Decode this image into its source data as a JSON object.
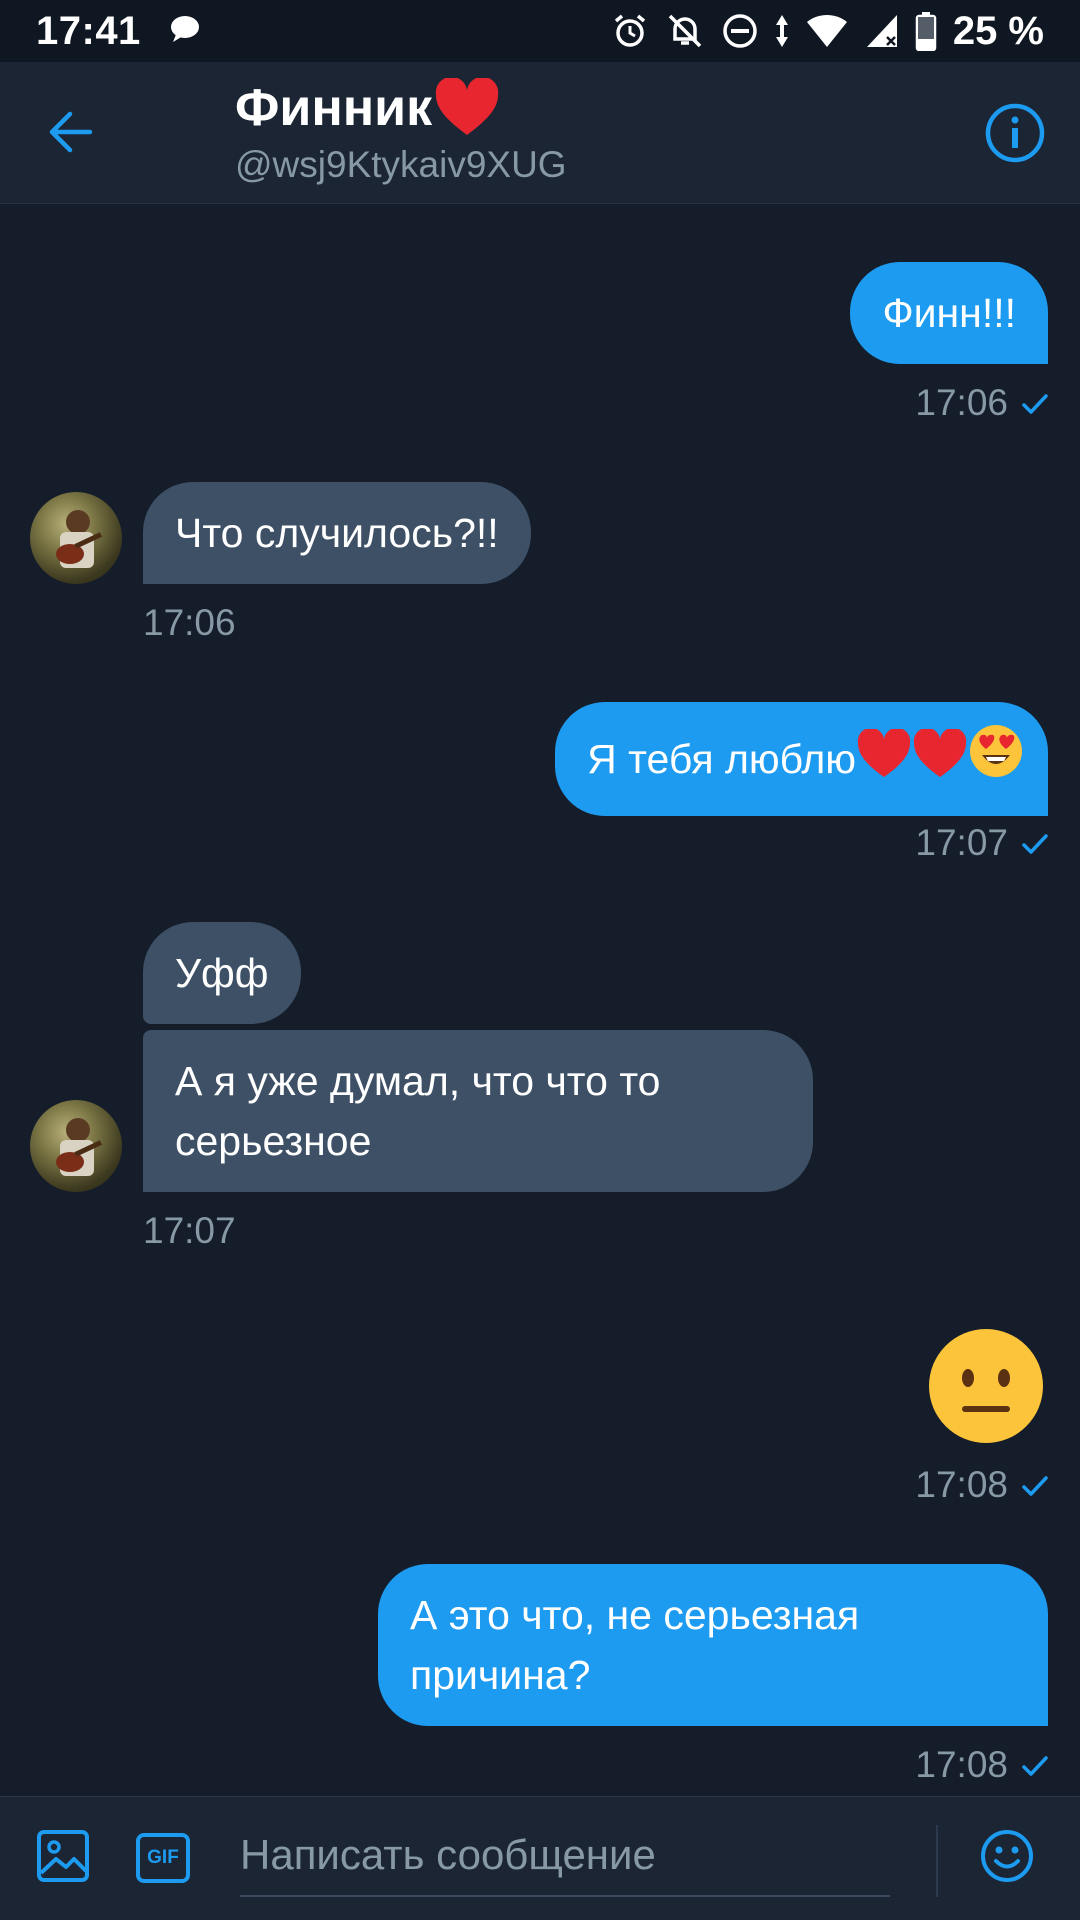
{
  "status_bar": {
    "time": "17:41",
    "battery": "25 %",
    "icons": [
      "chat-bubble-icon",
      "alarm-icon",
      "bell-off-icon",
      "do-not-disturb-icon",
      "data-arrows-icon",
      "wifi-icon",
      "signal-icon",
      "battery-icon"
    ]
  },
  "header": {
    "title": "Финник",
    "title_emoji": "red-heart",
    "handle": "@wsj9Ktykaiv9XUG",
    "back_icon": "arrow-left-icon",
    "info_icon": "info-icon"
  },
  "messages": [
    {
      "direction": "out",
      "text": "Финн!!!",
      "time": "17:06",
      "read": true
    },
    {
      "direction": "in",
      "text": "Что случилось?!!",
      "time": "17:06"
    },
    {
      "direction": "out",
      "text": "Я тебя люблю",
      "emojis": [
        "red-heart",
        "red-heart",
        "heart-eyes"
      ],
      "time": "17:07",
      "read": true
    },
    {
      "direction": "in",
      "text": "Уфф"
    },
    {
      "direction": "in",
      "text": "А я уже думал, что что то",
      "text_line2": "серьезное",
      "time": "17:07"
    },
    {
      "direction": "out",
      "emoji_only": "neutral-face",
      "time": "17:08",
      "read": true
    },
    {
      "direction": "out",
      "text": "А это что, не серьезная",
      "text_line2": "причина?",
      "time": "17:08",
      "read": true
    }
  ],
  "composer": {
    "placeholder": "Написать сообщение",
    "gif_label": "GIF",
    "icons": [
      "image-icon",
      "gif-icon",
      "emoji-icon"
    ]
  },
  "colors": {
    "background": "#151d2b",
    "header": "#1b2534",
    "accent": "#1d9bf0",
    "incoming_bubble": "#3d5065",
    "muted_text": "#8899a6"
  }
}
